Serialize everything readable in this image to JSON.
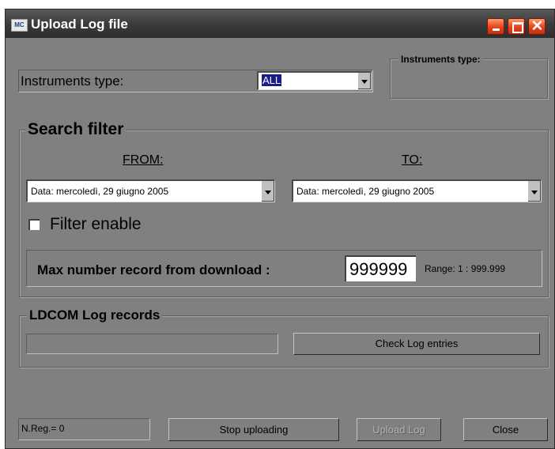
{
  "window": {
    "title": "Upload Log file",
    "app_icon_text": "MC"
  },
  "instruments": {
    "label": "Instruments type:",
    "selected": "ALL",
    "group_title": "Instruments type:"
  },
  "search_filter": {
    "title": "Search filter",
    "from_label": "FROM:",
    "to_label": "TO:",
    "from_value": "Data:  mercoledì,  29   giugno   2005",
    "to_value": "Data:  mercoledì,  29   giugno   2005",
    "filter_enable_label": "Filter enable",
    "filter_enable_checked": false,
    "max_record_label": "Max number record from download :",
    "max_record_value": "999999",
    "range_text": "Range: 1 : 999.999"
  },
  "ldcom": {
    "title": "LDCOM Log records",
    "progress": 0,
    "check_button": "Check Log entries"
  },
  "footer": {
    "status": "N.Reg.= 0",
    "stop_button": "Stop uploading",
    "upload_button": "Upload Log",
    "close_button": "Close"
  }
}
